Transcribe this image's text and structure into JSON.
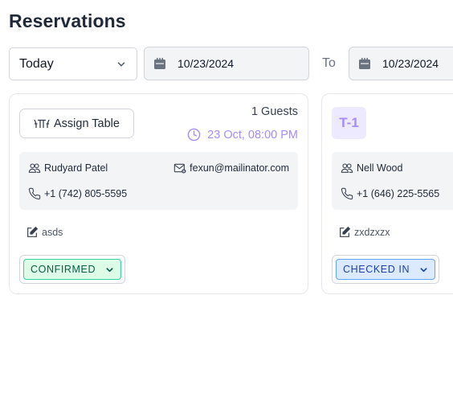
{
  "page": {
    "title": "Reservations"
  },
  "filters": {
    "period": {
      "selected": "Today"
    },
    "from_date": "10/23/2024",
    "to_label": "To",
    "to_date": "10/23/2024"
  },
  "reservations": [
    {
      "assign_table_label": "Assign Table",
      "guests": "1 Guests",
      "datetime": "23 Oct, 08:00 PM",
      "name": "Rudyard Patel",
      "email": "fexun@mailinator.com",
      "phone": "+1 (742) 805-5595",
      "note": "asds",
      "status": "CONFIRMED"
    },
    {
      "table": "T-1",
      "name": "Nell Wood",
      "phone": "+1 (646) 225-5565",
      "note": "zxdzxzx",
      "status": "CHECKED IN"
    }
  ],
  "colors": {
    "accent_purple": "#a78bfa",
    "confirmed": "#34d399",
    "checked_in": "#60a5fa"
  }
}
